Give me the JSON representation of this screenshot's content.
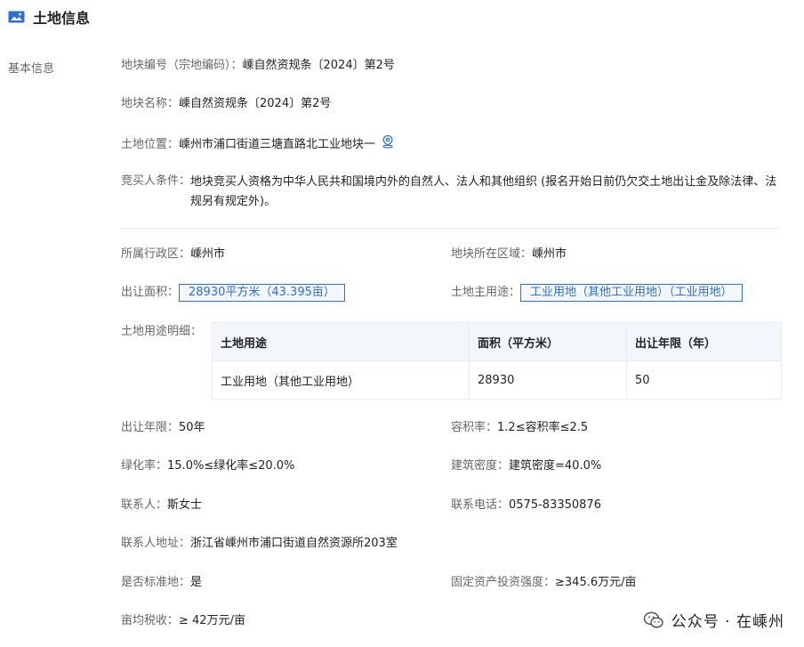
{
  "header": {
    "title": "土地信息"
  },
  "section": {
    "label": "基本信息"
  },
  "fields": {
    "plot_code": {
      "label": "地块编号（宗地编码）：",
      "value": "嵊自然资规条〔2024〕第2号"
    },
    "plot_name": {
      "label": "地块名称：",
      "value": "嵊自然资规条〔2024〕第2号"
    },
    "location": {
      "label": "土地位置：",
      "value": "嵊州市浦口街道三塘直路北工业地块一"
    },
    "bidder_req": {
      "label": "竞买人条件：",
      "value": "地块竞买人资格为中华人民共和国境内外的自然人、法人和其他组织 (报名开始日前仍欠交土地出让金及除法律、法规另有规定外)。"
    },
    "admin_region": {
      "label": "所属行政区：",
      "value": "嵊州市"
    },
    "plot_area_region": {
      "label": "地块所在区域：",
      "value": "嵊州市"
    },
    "transfer_area": {
      "label": "出让面积：",
      "value": "28930平方米（43.395亩）"
    },
    "main_use": {
      "label": "土地主用途：",
      "value": "工业用地（其他工业用地）（工业用地）"
    },
    "use_detail": {
      "label": "土地用途明细："
    },
    "transfer_term": {
      "label": "出让年限：",
      "value": "50年"
    },
    "plot_ratio": {
      "label": "容积率：",
      "value": "1.2≤容积率≤2.5"
    },
    "greening": {
      "label": "绿化率：",
      "value": "15.0%≤绿化率≤20.0%"
    },
    "building_density": {
      "label": "建筑密度：",
      "value": "建筑密度=40.0%"
    },
    "contact": {
      "label": "联系人：",
      "value": "斯女士"
    },
    "phone": {
      "label": "联系电话：",
      "value": "0575-83350876"
    },
    "address": {
      "label": "联系人地址：",
      "value": "浙江省嵊州市浦口街道自然资源所203室"
    },
    "standard": {
      "label": "是否标准地：",
      "value": "是"
    },
    "investment": {
      "label": "固定资产投资强度：",
      "value": "≥345.6万元/亩"
    },
    "tax": {
      "label": "亩均税收：",
      "value": "≥ 42万元/亩"
    }
  },
  "use_table": {
    "headers": [
      "土地用途",
      "面积（平方米）",
      "出让年限（年）"
    ],
    "rows": [
      [
        "工业用地（其他工业用地）",
        "28930",
        "50"
      ]
    ]
  },
  "watermark": {
    "text": "公众号 · 在嵊州"
  },
  "colors": {
    "accent": "#2f6fd0",
    "label": "#666666",
    "value": "#222222"
  },
  "icons": {
    "title": "image-card-icon",
    "location": "map-pin-icon",
    "watermark": "wechat-icon"
  }
}
